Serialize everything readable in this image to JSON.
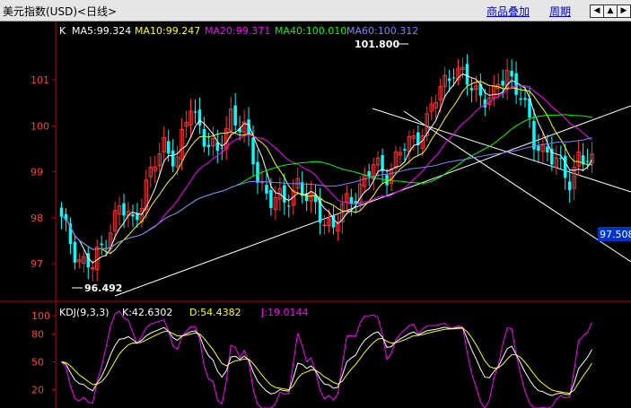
{
  "header": {
    "title": "美元指数(USD)<日线>",
    "overlay_label": "商品叠加",
    "period_label": "周期",
    "nav_buttons": [
      "left-arrow-icon",
      "up-arrow-icon",
      "right-arrow-icon"
    ]
  },
  "main_panel": {
    "prefix": "K",
    "ma_legend": [
      {
        "label": "MA5:99.324",
        "color": "#ffffff"
      },
      {
        "label": "MA10:99.247",
        "color": "#ffff00"
      },
      {
        "label": "MA20:99.371",
        "color": "#ff00ff"
      },
      {
        "label": "MA40:100.010",
        "color": "#00ff00"
      },
      {
        "label": "MA60:100.312",
        "color": "#8080ff"
      }
    ],
    "y_ticks": [
      "101",
      "100",
      "99",
      "98",
      "97"
    ],
    "high_label": "101.800",
    "low_label": "96.492",
    "current_price": "97.508"
  },
  "kdj_panel": {
    "legend": [
      {
        "label": "KDJ(9,3,3)",
        "color": "#ffffff"
      },
      {
        "label": "K:42.6302",
        "color": "#ffffff"
      },
      {
        "label": "D:54.4382",
        "color": "#ffff00"
      },
      {
        "label": "J:19.0144",
        "color": "#ff00ff"
      }
    ],
    "y_ticks": [
      "100",
      "80",
      "50",
      "20"
    ]
  },
  "colors": {
    "up": "#ff3232",
    "down": "#00ffff",
    "axis": "#c00000",
    "background": "#000000"
  },
  "chart_data": {
    "type": "candlestick",
    "y_range": [
      96.4,
      102.0
    ],
    "x_count": 120,
    "anchors_close": [
      [
        0,
        97.9
      ],
      [
        4,
        97.1
      ],
      [
        7,
        96.9
      ],
      [
        10,
        97.6
      ],
      [
        13,
        98.2
      ],
      [
        16,
        97.9
      ],
      [
        19,
        98.7
      ],
      [
        23,
        99.6
      ],
      [
        26,
        99.3
      ],
      [
        29,
        100.4
      ],
      [
        32,
        99.8
      ],
      [
        35,
        99.3
      ],
      [
        38,
        100.3
      ],
      [
        41,
        99.9
      ],
      [
        44,
        98.9
      ],
      [
        47,
        98.4
      ],
      [
        50,
        98.3
      ],
      [
        53,
        98.8
      ],
      [
        55,
        98.4
      ],
      [
        58,
        98.1
      ],
      [
        61,
        97.8
      ],
      [
        64,
        98.3
      ],
      [
        67,
        98.7
      ],
      [
        70,
        99.1
      ],
      [
        73,
        99.0
      ],
      [
        76,
        99.4
      ],
      [
        79,
        99.7
      ],
      [
        82,
        100.1
      ],
      [
        85,
        100.8
      ],
      [
        88,
        101.3
      ],
      [
        91,
        100.9
      ],
      [
        94,
        100.7
      ],
      [
        97,
        100.6
      ],
      [
        100,
        101.2
      ],
      [
        103,
        100.7
      ],
      [
        106,
        99.6
      ],
      [
        109,
        99.5
      ],
      [
        112,
        99.0
      ],
      [
        114,
        98.8
      ],
      [
        116,
        99.4
      ],
      [
        119,
        99.1
      ]
    ],
    "ma_series": [
      "MA5",
      "MA10",
      "MA20",
      "MA40",
      "MA60"
    ],
    "kdj": {
      "K": 42.6302,
      "D": 54.4382,
      "J": 19.0144
    }
  }
}
